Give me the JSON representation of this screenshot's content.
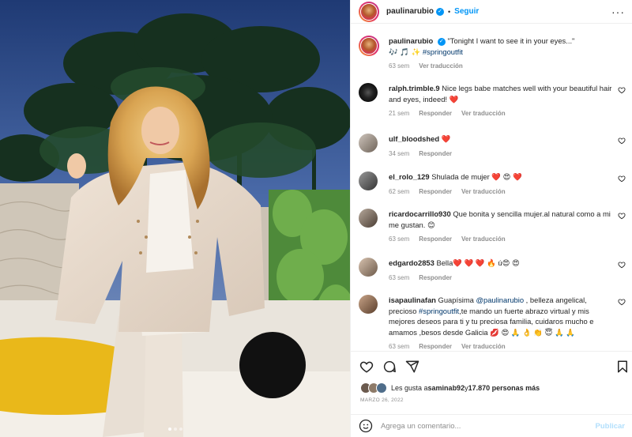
{
  "header": {
    "username": "paulinarubio",
    "separator": "•",
    "follow_label": "Seguir",
    "more_label": "···"
  },
  "caption": {
    "username": "paulinarubio",
    "text": "\"Tonight I want to see it in your eyes...\"",
    "emojis": "🎶 🎵 ✨",
    "hashtag": "#springoutfit",
    "time": "63 sem",
    "translate": "Ver traducción"
  },
  "comments": [
    {
      "username": "ralph.trimble.9",
      "text": "Nice legs babe matches well with your beautiful hair and eyes, indeed! ❤️",
      "time": "21 sem",
      "reply": "Responder",
      "translate": "Ver traducción"
    },
    {
      "username": "ulf_bloodshed",
      "text": "❤️",
      "time": "34 sem",
      "reply": "Responder"
    },
    {
      "username": "el_rolo_129",
      "text": "Shulada de mujer ❤️ 😍 ❤️",
      "time": "62 sem",
      "reply": "Responder",
      "translate": "Ver traducción"
    },
    {
      "username": "ricardocarrillo930",
      "text": "Que bonita y sencilla mujer.al natural como a mi me gustan. 😊",
      "time": "63 sem",
      "reply": "Responder",
      "translate": "Ver traducción"
    },
    {
      "username": "edgardo2853",
      "text": "Bella❤️ ❤️ ❤️ 🔥 ú😍 😍",
      "time": "63 sem",
      "reply": "Responder"
    },
    {
      "username": "isapaulinafan",
      "text_pre": "Guapísima ",
      "mention": "@paulinarubio",
      "text_mid": " , belleza angelical, precioso ",
      "hashtag": "#springoutfit",
      "text_post": ",te mando un fuerte abrazo virtual y mis mejores deseos para ti y tu preciosa familia, cuidaros mucho e amamos ,besos desde Galicia 💋 😍 🙏 👌 👏 😇 🙏 🙏",
      "time": "63 sem",
      "reply": "Responder",
      "translate": "Ver traducción"
    }
  ],
  "likes": {
    "prefix": "Les gusta a ",
    "user": "saminab92",
    "mid": " y ",
    "count": "17.870 personas más"
  },
  "date": "MARZO 26, 2022",
  "add_comment": {
    "placeholder": "Agrega un comentario...",
    "post_label": "Publicar"
  },
  "icons": {
    "like": "heart-icon",
    "comment": "comment-icon",
    "share": "share-icon",
    "save": "bookmark-icon",
    "emoji": "emoji-icon"
  },
  "colors": {
    "accent": "#0095f6",
    "link": "#00376b",
    "muted": "#8e8e8e",
    "heart": "#ed4956"
  }
}
